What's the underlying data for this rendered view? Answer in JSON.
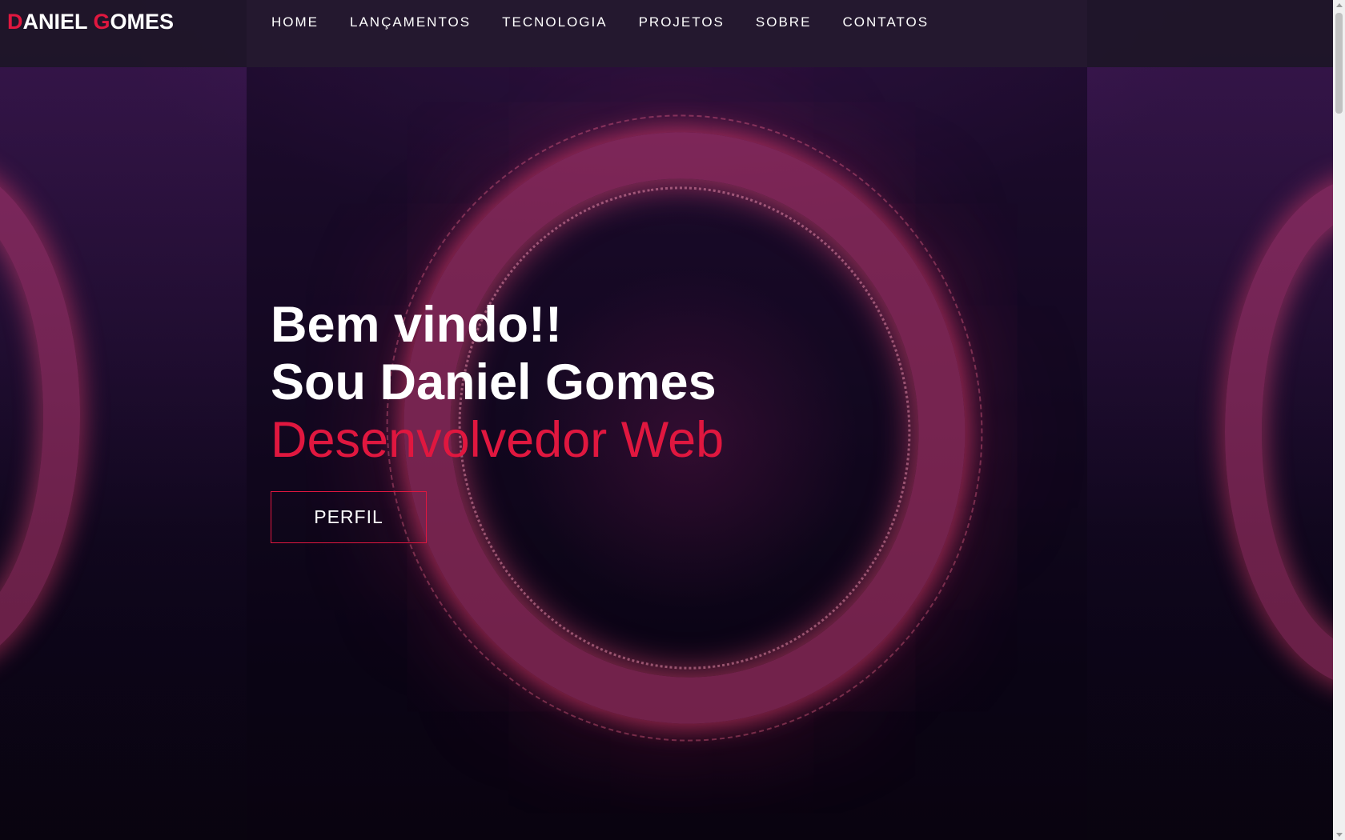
{
  "header": {
    "logo": {
      "first_initial": "D",
      "first_rest": "ANIEL ",
      "last_initial": "G",
      "last_rest": "OMES"
    },
    "nav": [
      {
        "label": "HOME"
      },
      {
        "label": "LANÇAMENTOS"
      },
      {
        "label": "TECNOLOGIA"
      },
      {
        "label": "PROJETOS"
      },
      {
        "label": "SOBRE"
      },
      {
        "label": "CONTATOS"
      }
    ]
  },
  "hero": {
    "greeting": "Bem vindo!!",
    "name_line": "Sou Daniel Gomes",
    "role": "Desenvolvedor Web",
    "button_label": "PERFIL"
  },
  "colors": {
    "accent": "#e0173f",
    "text": "#ffffff",
    "header_bg": "#1e1628"
  }
}
